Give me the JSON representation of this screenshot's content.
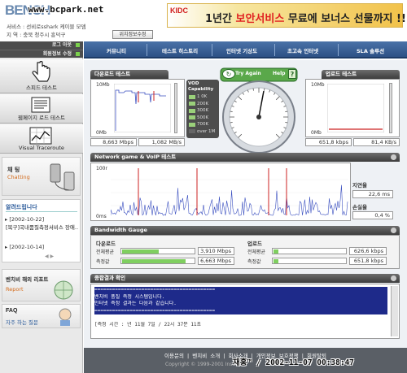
{
  "watermark": "www.bcpark.net",
  "logo_text": "BENCH",
  "user": {
    "service_label": "서비스 : 선비로sshark 케이블 모뎀",
    "region_label": "지  역 : 충북 청주시 흥덕구",
    "edit_button": "위치정보수정"
  },
  "ad": {
    "brand": "KIDC",
    "text_pre": "1년간 ",
    "text_hl": "보안서비스",
    "text_mid": " 무료에 보너스 ",
    "text_end": "선물까지 !!"
  },
  "left": {
    "logout": "로그 아웃",
    "member_edit": "회원정보 수정",
    "menus": [
      "스피드 테스트",
      "웹페이지 로드 테스트",
      "Visual Traceroute"
    ],
    "chatting_kr": "채 팅",
    "chatting_en": "Chatting",
    "notice_title": "알려드립니다",
    "notices": [
      {
        "date": "[2002-10-22]",
        "text": "[복구]국내품질측정서비스 장애.."
      },
      {
        "date": "[2002-10-14]",
        "text": ""
      }
    ],
    "report_kr": "벤치비 해외 리포트",
    "report_en": "Report",
    "faq": "FAQ",
    "faq_sub": "자주 하는 질문"
  },
  "nav": [
    "커뮤니티",
    "테스트 히스토리",
    "인터넷 기상도",
    "초고속 인터넷",
    "SLA 솔루션"
  ],
  "download": {
    "title": "다운로드 테스트",
    "top": "10Mb",
    "bottom": "0Mb",
    "mbps": "8,663 Mbps",
    "mbs": "1,082 MB/s"
  },
  "upload": {
    "title": "업로드 테스트",
    "top": "10Mb",
    "bottom": "0Mb",
    "mbps": "651,8 kbps",
    "kbs": "81,4 KB/s"
  },
  "vod": {
    "title": "VOD Capability",
    "levels": [
      "1 0K",
      "200K",
      "300K",
      "500K",
      "700K",
      "over 1M"
    ],
    "lit": 5
  },
  "gauge": {
    "try_again": "Try Again",
    "help": "Help",
    "help_q": "?"
  },
  "network": {
    "title": "Network game & VoIP 테스트",
    "top": "100r",
    "bottom": "0ms",
    "delay_label": "지연율",
    "delay_value": "22,6 ms",
    "loss_label": "손실율",
    "loss_value": "0,4 %"
  },
  "bandwidth": {
    "title": "Bandwidth Gauge",
    "down": {
      "title": "다운로드",
      "rows": [
        {
          "label": "전체평균",
          "value": "3,910 Mbps",
          "fill": 0.5
        },
        {
          "label": "측정값",
          "value": "6,663 Mbps",
          "fill": 0.87
        }
      ]
    },
    "up": {
      "title": "업로드",
      "rows": [
        {
          "label": "전체평균",
          "value": "626,6 kbps",
          "fill": 0.07
        },
        {
          "label": "측정값",
          "value": "651,8 kbps",
          "fill": 0.07
        }
      ]
    }
  },
  "result": {
    "title": "종합결과 확인",
    "lines": [
      "=========================================",
      "벤치비 품질 측정 시스템입니다.",
      "인터넷 측정 결과는 다음과 같습니다.",
      "=========================================",
      "",
      "[측정 시간 :        년 11월 7일 / 22시 37분 11초"
    ]
  },
  "footer": {
    "links": [
      "이용문의",
      "벤치비 소개",
      "회사소개",
      "개인정보 보호정책",
      "회원탈퇴"
    ],
    "copy": "Copyright © 1999-2001 Insun"
  },
  "timestamp": "재홍™ / 2002-11-07 00:38:47",
  "colors": {
    "nav": "#2d5185",
    "accent_green": "#7bd04c",
    "graph_line": "#3a4fc0",
    "graph_peak": "#cc2222"
  }
}
